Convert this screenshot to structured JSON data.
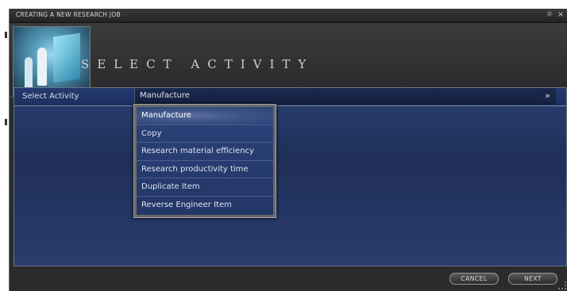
{
  "window": {
    "title": "CREATING A NEW RESEARCH JOB"
  },
  "header": {
    "title": "SELECT ACTIVITY",
    "image_icon": "scientists-lab-image"
  },
  "form": {
    "row_label": "Select Activity",
    "selected_value": "Manufacture",
    "chevron_icon": "double-chevron-down-icon"
  },
  "dropdown": {
    "items": [
      {
        "label": "Manufacture",
        "selected": true
      },
      {
        "label": "Copy",
        "selected": false
      },
      {
        "label": "Research material efficiency",
        "selected": false
      },
      {
        "label": "Research productivity time",
        "selected": false
      },
      {
        "label": "Duplicate Item",
        "selected": false
      },
      {
        "label": "Reverse Engineer Item",
        "selected": false
      }
    ]
  },
  "footer": {
    "cancel_label": "CANCEL",
    "next_label": "NEXT"
  },
  "colors": {
    "panel_blue": "#24376a",
    "window_bg": "#2b2b2c",
    "text_light": "#dde2ee"
  }
}
